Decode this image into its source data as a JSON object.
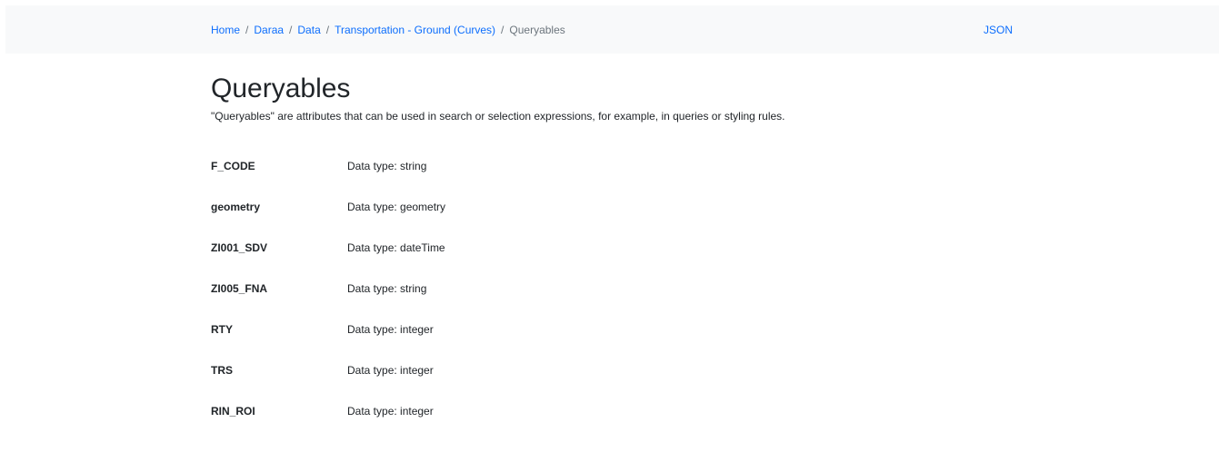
{
  "breadcrumb": {
    "items": [
      "Home",
      "Daraa",
      "Data",
      "Transportation - Ground (Curves)"
    ],
    "separator": "/",
    "active": "Queryables"
  },
  "nav": {
    "json_link": "JSON"
  },
  "page": {
    "title": "Queryables",
    "description": "\"Queryables\" are attributes that can be used in search or selection expressions, for example, in queries or styling rules."
  },
  "queryables": [
    {
      "name": "F_CODE",
      "type": "Data type: string"
    },
    {
      "name": "geometry",
      "type": "Data type: geometry"
    },
    {
      "name": "ZI001_SDV",
      "type": "Data type: dateTime"
    },
    {
      "name": "ZI005_FNA",
      "type": "Data type: string"
    },
    {
      "name": "RTY",
      "type": "Data type: integer"
    },
    {
      "name": "TRS",
      "type": "Data type: integer"
    },
    {
      "name": "RIN_ROI",
      "type": "Data type: integer"
    }
  ],
  "colors": {
    "link": "#0d6efd",
    "muted": "#6c757d",
    "navbar_bg": "#f8f9fa",
    "text": "#212529"
  }
}
